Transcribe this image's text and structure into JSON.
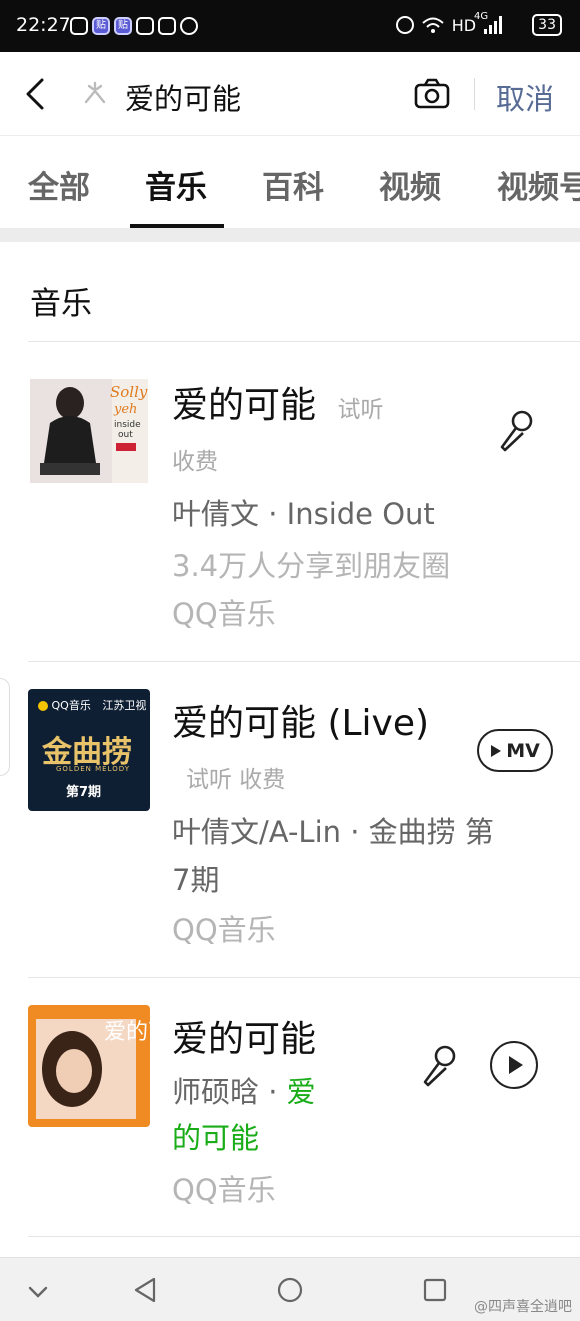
{
  "status_bar": {
    "time": "22:27",
    "notif_icons": [
      "message-icon",
      "tieba-icon",
      "tieba-icon",
      "wechat-icon",
      "gallery-icon",
      "app-icon"
    ],
    "tieba_label": "贴",
    "network": "HD",
    "signal_label": "4G",
    "battery": "33"
  },
  "search": {
    "query": "爱的可能",
    "cancel_label": "取消"
  },
  "tabs": [
    {
      "label": "全部",
      "active": false
    },
    {
      "label": "音乐",
      "active": true
    },
    {
      "label": "百科",
      "active": false
    },
    {
      "label": "视频",
      "active": false
    },
    {
      "label": "视频号",
      "active": false
    }
  ],
  "section": {
    "title": "音乐"
  },
  "results": [
    {
      "title": "爱的可能",
      "tags": "试听",
      "tags2": "收费",
      "artist_album": "叶倩文 · Inside Out",
      "share_count": "3.4万人分享到朋友圈",
      "source": "QQ音乐",
      "cover_text": "Sally Yeh Inside Out"
    },
    {
      "title": "爱的可能 (Live)",
      "tags": "试听 收费",
      "artist_album_line1": "叶倩文/A-Lin · 金曲捞 第",
      "artist_album_line2": "7期",
      "source": "QQ音乐",
      "mv_label": "MV",
      "cover_brand": "QQ音乐",
      "cover_channel": "江苏卫视",
      "cover_show": "金曲捞",
      "cover_sub": "GOLDEN MELODY",
      "cover_episode": "第7期"
    },
    {
      "title": "爱的可能",
      "artist_line1": "师硕晗 · ",
      "artist_highlight1": "爱",
      "artist_highlight2": "的可能",
      "source": "QQ音乐",
      "cover_text": "爱的可能"
    }
  ],
  "nav": {
    "watermark": "@四声喜全逍吧"
  },
  "colors": {
    "accent_link": "#576b95",
    "highlight_green": "#1aad19",
    "status_bar": "#0c0c0c"
  }
}
